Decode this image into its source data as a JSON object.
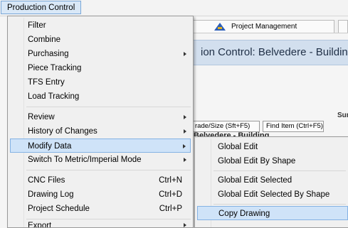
{
  "menubar": {
    "active_menu": "Production Control"
  },
  "background": {
    "tab_project_management": "Project Management",
    "title_banner": "ion Control: Belvedere - Building",
    "su_label": "Sur",
    "trade_size_button": "rade/Size (Sft+F5)",
    "find_item_button": "Find Item (Ctrl+F5)",
    "clipped_row_text": "Belvedere - Building"
  },
  "main_menu": {
    "items": [
      {
        "label": "Filter"
      },
      {
        "label": "Combine"
      },
      {
        "label": "Purchasing",
        "submenu": true
      },
      {
        "label": "Piece Tracking"
      },
      {
        "label": "TFS Entry"
      },
      {
        "label": "Load Tracking"
      },
      {
        "label": "Review",
        "submenu": true
      },
      {
        "label": "History of Changes",
        "submenu": true
      },
      {
        "label": "Modify Data",
        "submenu": true,
        "highlighted": true
      },
      {
        "label": "Switch To Metric/Imperial Mode",
        "submenu": true
      },
      {
        "label": "CNC Files",
        "shortcut": "Ctrl+N"
      },
      {
        "label": "Drawing Log",
        "shortcut": "Ctrl+D"
      },
      {
        "label": "Project Schedule",
        "shortcut": "Ctrl+P"
      },
      {
        "label": "Export",
        "submenu": true
      }
    ]
  },
  "sub_menu": {
    "items": [
      {
        "label": "Global Edit"
      },
      {
        "label": "Global Edit By Shape"
      },
      {
        "label": "Global Edit Selected"
      },
      {
        "label": "Global Edit Selected By Shape"
      },
      {
        "label": "Copy Drawing",
        "highlighted": true
      }
    ]
  },
  "colors": {
    "menu_highlight": "#cfe3f8",
    "menu_highlight_border": "#84b2e4",
    "title_banner_bg": "#d2dfee"
  }
}
